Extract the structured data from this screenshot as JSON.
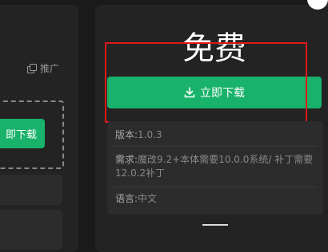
{
  "left": {
    "promote_label": "推广",
    "download_label": "即下载"
  },
  "product": {
    "price": "免费",
    "download_label": "立即下载"
  },
  "info": {
    "version_key": "版本:",
    "version_value": "1.0.3",
    "requirement_key": "需求:",
    "requirement_value": "魔改9.2+本体需要10.0.0系统/ 补丁需要12.0.2补丁",
    "language_key": "语言:",
    "language_value": "中文"
  },
  "colors": {
    "accent": "#18b26b",
    "highlight": "#e01818"
  }
}
